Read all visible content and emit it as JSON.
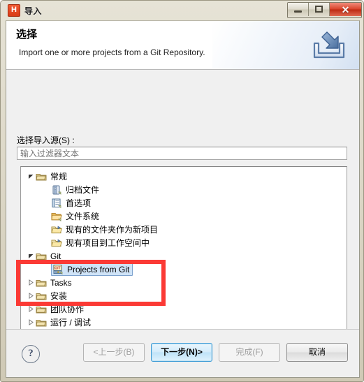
{
  "window": {
    "title": "导入",
    "app_logo_letter": "H",
    "controls": {
      "minimize": "minimize-button",
      "maximize": "maximize-button",
      "close": "✕"
    }
  },
  "header": {
    "title": "选择",
    "description": "Import one or more projects from a Git Repository.",
    "icon": "import-icon"
  },
  "form": {
    "source_label": "选择导入源(S) :",
    "filter_placeholder": "输入过滤器文本",
    "filter_value": ""
  },
  "tree": {
    "items": [
      {
        "label": "常规",
        "icon": "folder-icon",
        "level": 0,
        "state": "expanded",
        "selected": false
      },
      {
        "label": "归档文件",
        "icon": "archive-icon",
        "level": 1,
        "state": "leaf",
        "selected": false
      },
      {
        "label": "首选项",
        "icon": "preferences-icon",
        "level": 1,
        "state": "leaf",
        "selected": false
      },
      {
        "label": "文件系统",
        "icon": "filesystem-icon",
        "level": 1,
        "state": "leaf",
        "selected": false
      },
      {
        "label": "现有的文件夹作为新项目",
        "icon": "open-folder-icon",
        "level": 1,
        "state": "leaf",
        "selected": false
      },
      {
        "label": "现有项目到工作空间中",
        "icon": "open-folder-icon",
        "level": 1,
        "state": "leaf",
        "selected": false
      },
      {
        "label": "Git",
        "icon": "folder-icon",
        "level": 0,
        "state": "expanded",
        "selected": false
      },
      {
        "label": "Projects from Git",
        "icon": "git-icon",
        "level": 1,
        "state": "leaf",
        "selected": true
      },
      {
        "label": "Tasks",
        "icon": "folder-icon",
        "level": 0,
        "state": "collapsed",
        "selected": false
      },
      {
        "label": "安装",
        "icon": "folder-icon",
        "level": 0,
        "state": "collapsed",
        "selected": false
      },
      {
        "label": "团队协作",
        "icon": "folder-icon",
        "level": 0,
        "state": "collapsed",
        "selected": false
      },
      {
        "label": "运行 / 调试",
        "icon": "folder-icon",
        "level": 0,
        "state": "collapsed",
        "selected": false
      }
    ]
  },
  "annotation": {
    "color": "#fb3a35",
    "shape": "rectangle"
  },
  "footer": {
    "help_label": "?",
    "buttons": [
      {
        "label": "<上一步(B)",
        "state": "disabled"
      },
      {
        "label": "下一步(N)>",
        "state": "default"
      },
      {
        "label": "完成(F)",
        "state": "disabled"
      },
      {
        "label": "取消",
        "state": "enabled"
      }
    ]
  }
}
